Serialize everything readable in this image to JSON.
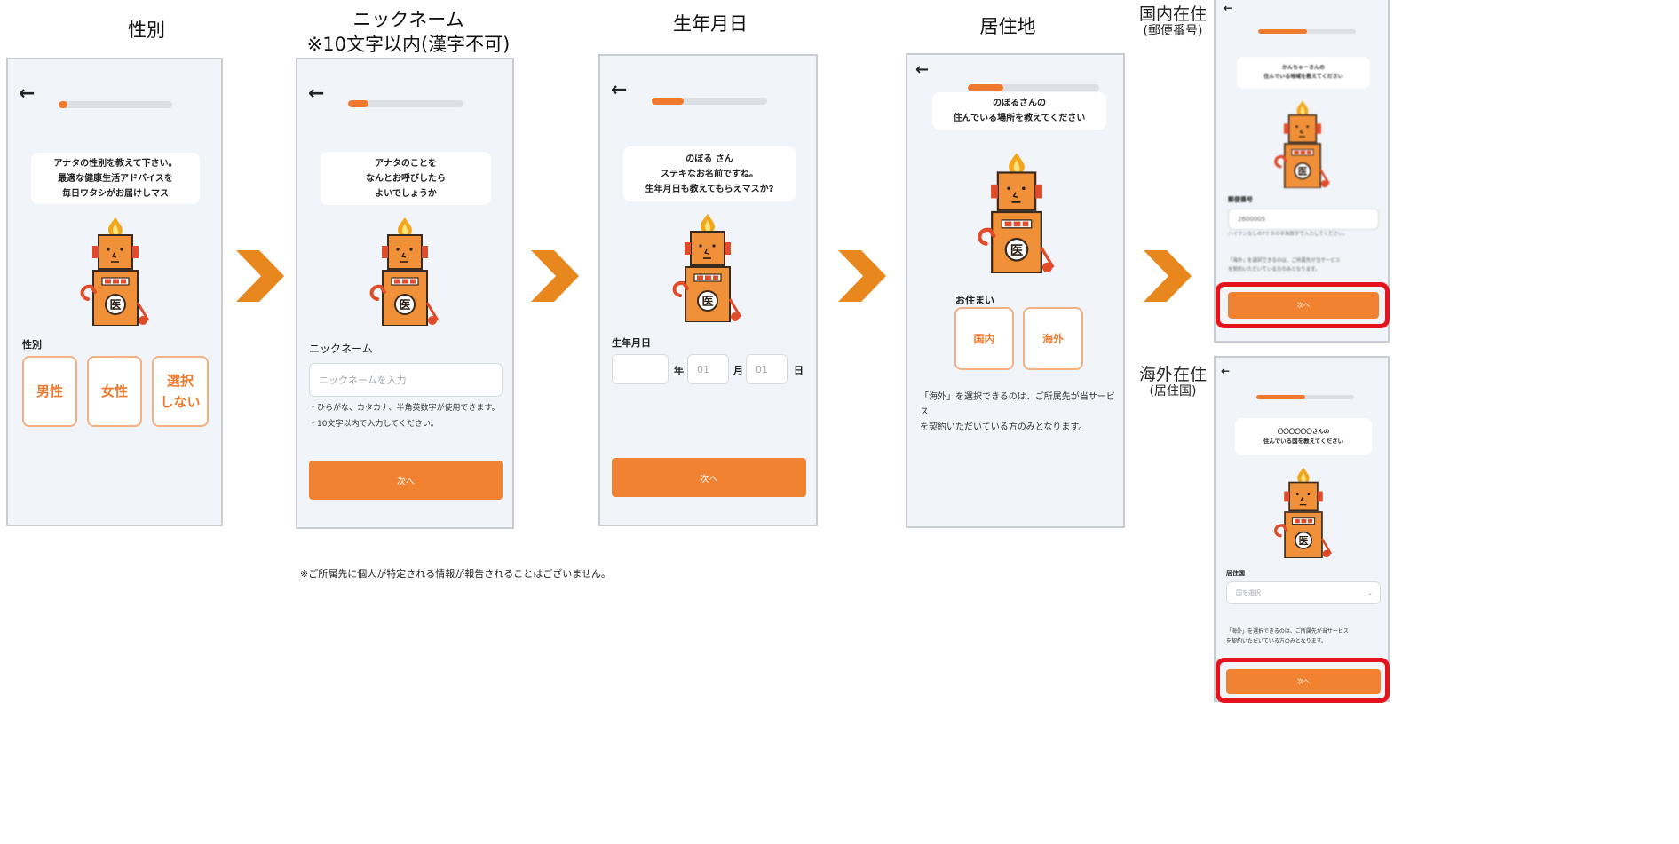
{
  "colors": {
    "accent": "#ef7a2f",
    "arrow": "#e8871e",
    "highlight": "#e4131c"
  },
  "titles": {
    "gender": "性別",
    "nickname_line1": "ニックネーム",
    "nickname_line2": "※10文字以内(漢字不可)",
    "birthday": "生年月日",
    "residence": "居住地",
    "domestic_line1": "国内在住",
    "domestic_line2": "(郵便番号)",
    "overseas_line1": "海外在住",
    "overseas_line2": "(居住国)"
  },
  "footnote": "※ご所属先に個人が特定される情報が報告されることはございません。",
  "screen1": {
    "back": "←",
    "progress": 0.08,
    "bubble": [
      "アナタの性別を教えて下さい。",
      "最適な健康生活アドバイスを",
      "毎日ワタシがお届けしマス"
    ],
    "field_label": "性別",
    "options": [
      "男性",
      "女性",
      "選択\nしない"
    ]
  },
  "screen2": {
    "back": "←",
    "progress": 0.18,
    "bubble": [
      "アナタのことを",
      "なんとお呼びしたら",
      "よいでしょうか"
    ],
    "field_label": "ニックネーム",
    "placeholder": "ニックネームを入力",
    "notes": [
      "・ひらがな、カタカナ、半角英数字が使用できます。",
      "・10文字以内で入力してください。"
    ],
    "next": "次へ"
  },
  "screen3": {
    "back": "←",
    "progress": 0.28,
    "bubble": [
      "のぼる さん",
      "ステキなお名前ですね。",
      "生年月日も教えてもらえマスか?"
    ],
    "field_label": "生年月日",
    "year_value": "",
    "year_unit": "年",
    "month_value": "01",
    "month_unit": "月",
    "day_value": "01",
    "day_unit": "日",
    "next": "次へ"
  },
  "screen4": {
    "back": "←",
    "progress": 0.27,
    "bubble": [
      "のぼるさんの",
      "住んでいる場所を教えてください"
    ],
    "field_label": "お住まい",
    "options": [
      "国内",
      "海外"
    ],
    "note": [
      "「海外」を選択できるのは、ご所属先が当サービス",
      "を契約いただいている方のみとなります。"
    ]
  },
  "screen5": {
    "back": "←",
    "progress": 0.5,
    "bubble": [
      "かんちゃーさんの",
      "住んでいる地域を教えてください"
    ],
    "field_label": "郵便番号",
    "input_value": "2600005",
    "hint": "ハイフンなしの7ケタの半角数字で入力してください。",
    "note": [
      "「海外」を選択できるのは、ご所属先が当サービス",
      "を契約いただいている方のみとなります。"
    ],
    "next": "次へ"
  },
  "screen6": {
    "back": "←",
    "progress": 0.5,
    "bubble": [
      "〇〇〇〇〇〇さんの",
      "住んでいる国を教えてください"
    ],
    "field_label": "居住国",
    "select_placeholder": "国を選択",
    "note": [
      "「海外」を選択できるのは、ご所属先が当サービス",
      "を契約いただいている方のみとなります。"
    ],
    "next": "次へ"
  }
}
